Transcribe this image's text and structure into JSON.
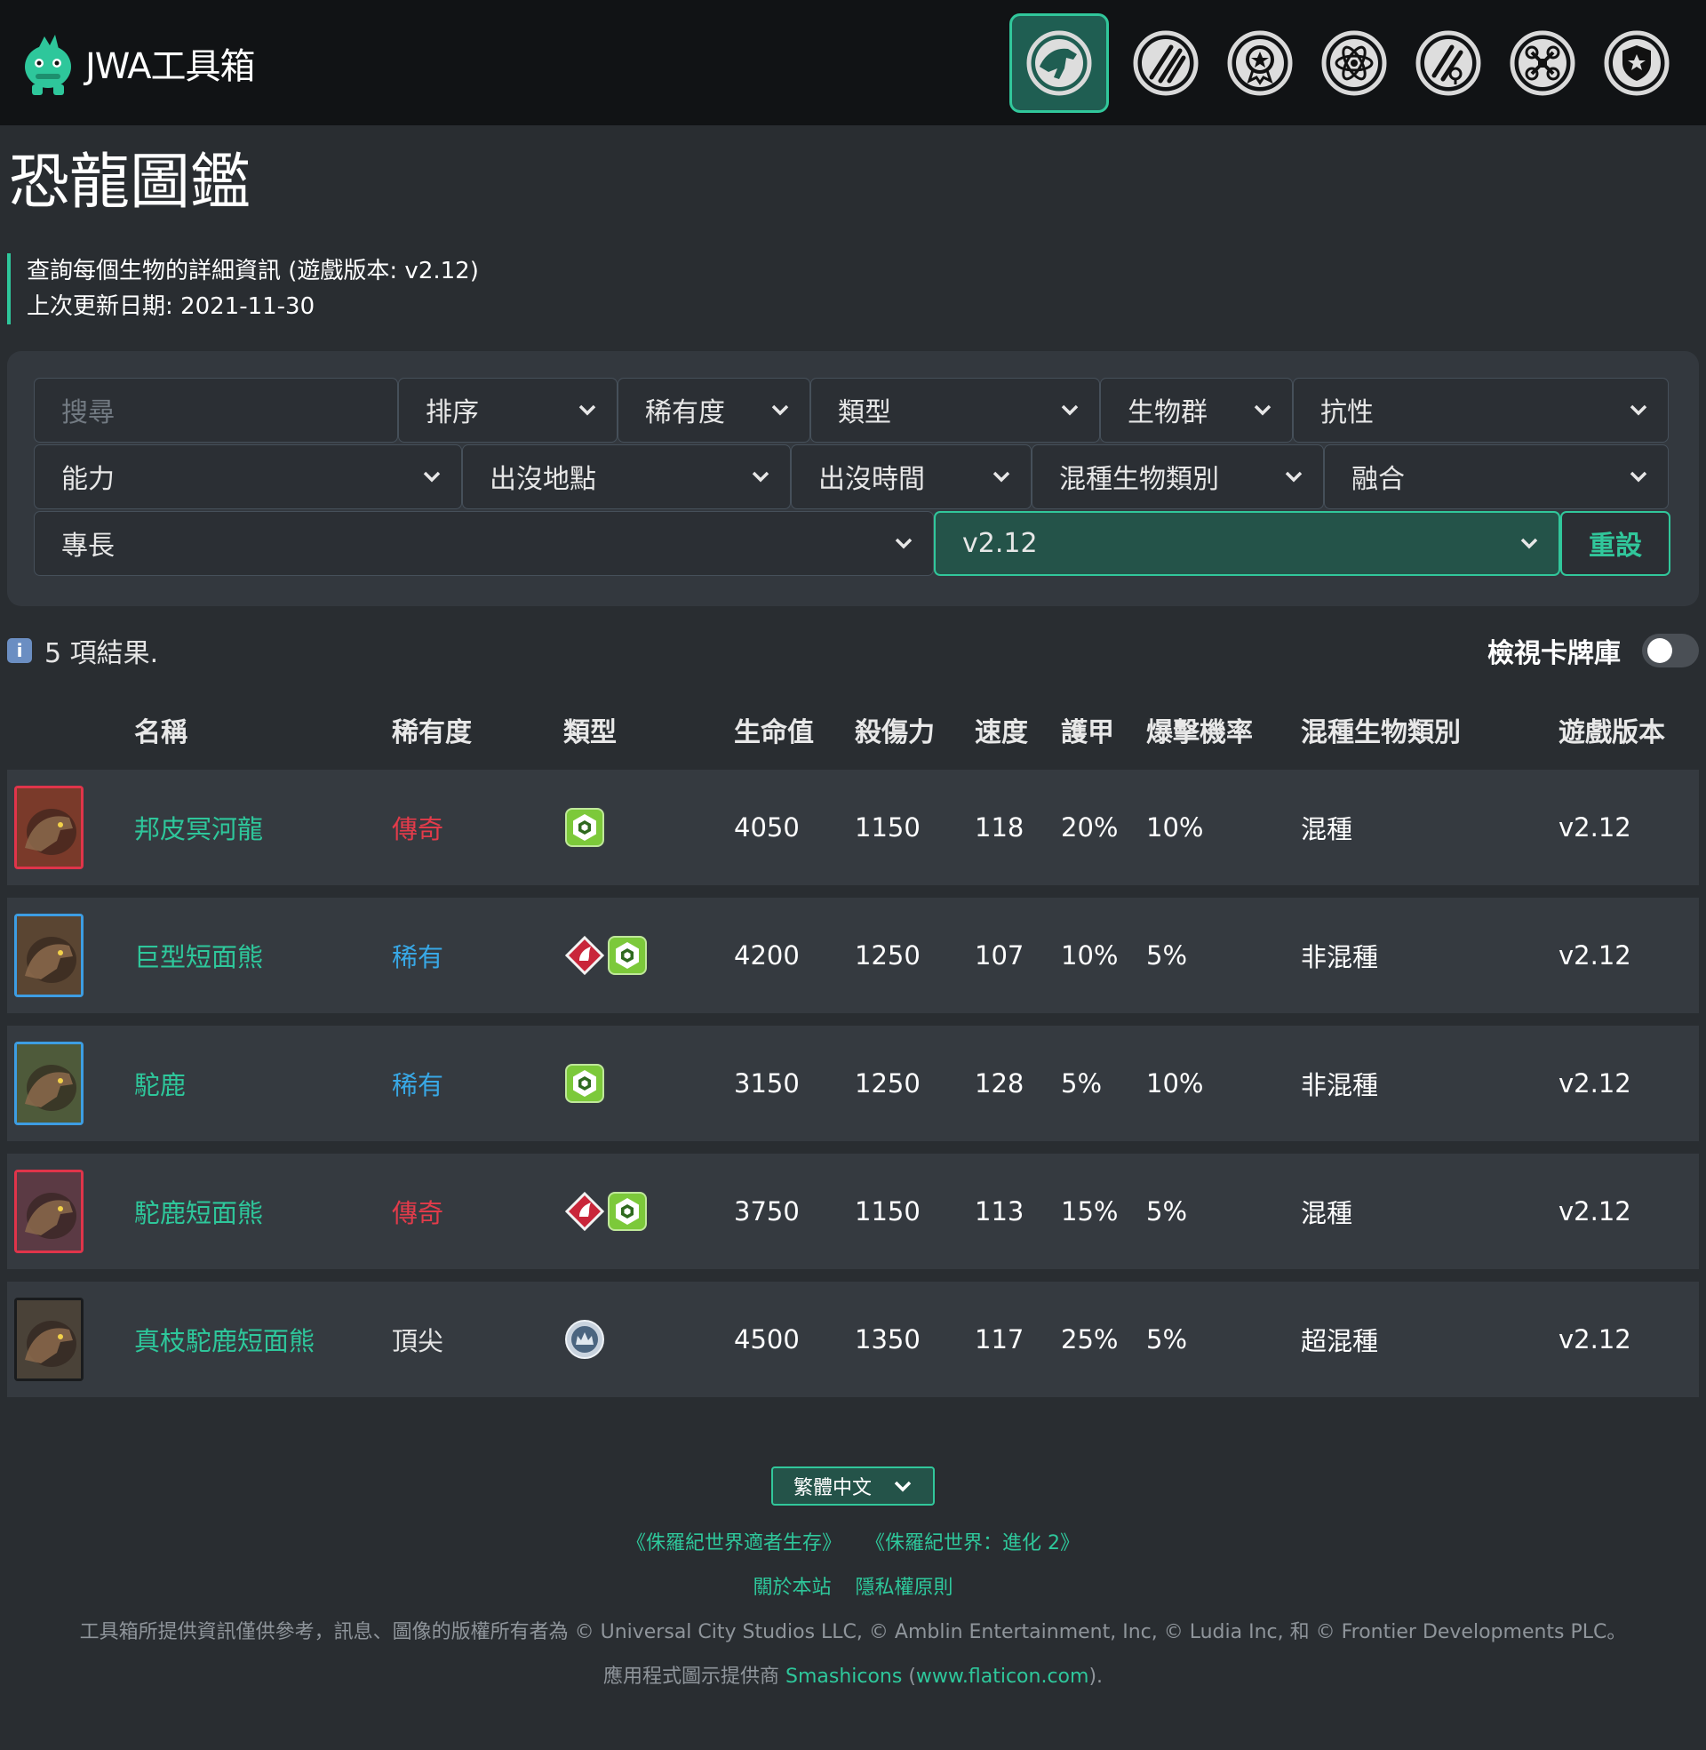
{
  "app": {
    "name": "JWA工具箱"
  },
  "nav": {
    "items": [
      {
        "name": "dino-icon",
        "active": true
      },
      {
        "name": "claw-icon"
      },
      {
        "name": "medal-icon"
      },
      {
        "name": "atom-icon"
      },
      {
        "name": "fang-icon"
      },
      {
        "name": "drone-icon"
      },
      {
        "name": "shield-badge-icon"
      }
    ]
  },
  "page": {
    "title": "恐龍圖鑑",
    "desc": "查詢每個生物的詳細資訊 (遊戲版本: v2.12)",
    "updated": "上次更新日期: 2021-11-30"
  },
  "filters": {
    "search_placeholder": "搜尋",
    "sort": "排序",
    "rarity": "稀有度",
    "type": "類型",
    "group": "生物群",
    "resistance": "抗性",
    "ability": "能力",
    "location": "出沒地點",
    "time": "出沒時間",
    "hybrid_type": "混種生物類別",
    "fusion": "融合",
    "specialty": "專長",
    "version": "v2.12",
    "reset": "重設"
  },
  "results": {
    "count_text": "5 項結果.",
    "toggle_label": "檢視卡牌庫"
  },
  "table": {
    "headers": [
      "名稱",
      "稀有度",
      "類型",
      "生命值",
      "殺傷力",
      "速度",
      "護甲",
      "爆擊機率",
      "混種生物類別",
      "遊戲版本"
    ],
    "rows": [
      {
        "name": "邦皮冥河龍",
        "rarity": "傳奇",
        "rarity_class": "rar-legendary",
        "types": [
          "resilient"
        ],
        "hp": "4050",
        "dmg": "1150",
        "speed": "118",
        "armor": "20%",
        "crit": "10%",
        "hybrid": "混種",
        "version": "v2.12",
        "frame": "#e0344a",
        "art": "#7a3a2a"
      },
      {
        "name": "巨型短面熊",
        "rarity": "稀有",
        "rarity_class": "rar-rare",
        "types": [
          "fierce",
          "resilient"
        ],
        "hp": "4200",
        "dmg": "1250",
        "speed": "107",
        "armor": "10%",
        "crit": "5%",
        "hybrid": "非混種",
        "version": "v2.12",
        "frame": "#3d9de3",
        "art": "#5a4532"
      },
      {
        "name": "駝鹿",
        "rarity": "稀有",
        "rarity_class": "rar-rare",
        "types": [
          "resilient"
        ],
        "hp": "3150",
        "dmg": "1250",
        "speed": "128",
        "armor": "5%",
        "crit": "10%",
        "hybrid": "非混種",
        "version": "v2.12",
        "frame": "#3d9de3",
        "art": "#4e5a3a"
      },
      {
        "name": "駝鹿短面熊",
        "rarity": "傳奇",
        "rarity_class": "rar-legendary",
        "types": [
          "fierce",
          "resilient"
        ],
        "hp": "3750",
        "dmg": "1150",
        "speed": "113",
        "armor": "15%",
        "crit": "5%",
        "hybrid": "混種",
        "version": "v2.12",
        "frame": "#e0344a",
        "art": "#5b3a44"
      },
      {
        "name": "真枝駝鹿短面熊",
        "rarity": "頂尖",
        "rarity_class": "rar-apex",
        "types": [
          "apex"
        ],
        "hp": "4500",
        "dmg": "1350",
        "speed": "117",
        "armor": "25%",
        "crit": "5%",
        "hybrid": "超混種",
        "version": "v2.12",
        "frame": "#1a1c1e",
        "art": "#4a4238"
      }
    ]
  },
  "footer": {
    "language": "繁體中文",
    "link_survival": "《侏羅紀世界適者生存》",
    "link_evolution": "《侏羅紀世界：進化 2》",
    "about": "關於本站",
    "privacy": "隱私權原則",
    "copyright": "工具箱所提供資訊僅供參考，訊息、圖像的版權所有者為 © Universal City Studios LLC, © Amblin Entertainment, Inc, © Ludia Inc, 和 © Frontier Developments PLC。",
    "credit_prefix": "應用程式圖示提供商 ",
    "credit_author": "Smashicons",
    "credit_paren_open": " (",
    "credit_site": "www.flaticon.com",
    "credit_paren_close": ")."
  },
  "colors": {
    "accent": "#31c79b",
    "legendary": "#e23b4a",
    "rare": "#38a8e6",
    "background": "#292d31",
    "topbar": "#111315"
  }
}
